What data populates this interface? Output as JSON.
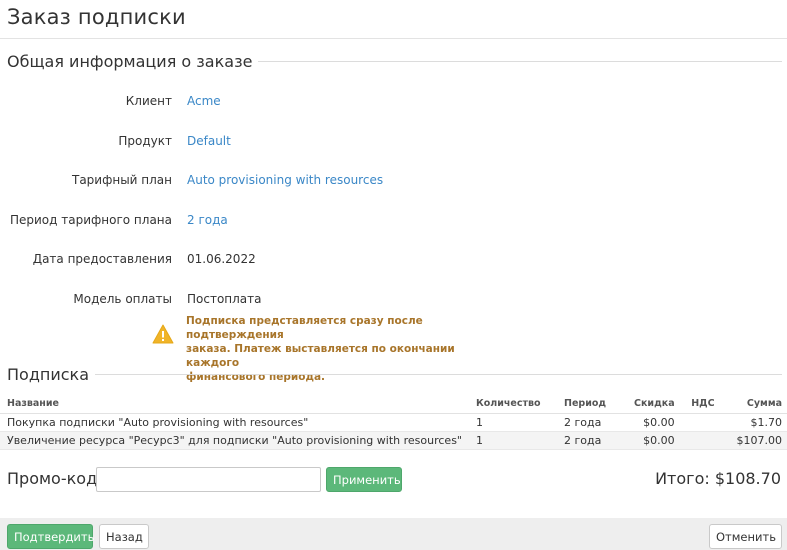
{
  "page": {
    "title": "Заказ подписки"
  },
  "general": {
    "legend": "Общая информация о заказе",
    "fields": [
      {
        "label": "Клиент",
        "value": "Acme"
      },
      {
        "label": "Продукт",
        "value": "Default"
      },
      {
        "label": "Тарифный план",
        "value": "Auto provisioning with resources"
      },
      {
        "label": "Период тарифного плана",
        "value": "2 года"
      },
      {
        "label": "Дата предоставления",
        "value": "01.06.2022"
      },
      {
        "label": "Модель оплаты",
        "value": "Постоплата"
      }
    ],
    "warning": {
      "icon": "warning-triangle-icon",
      "color": "#a8752a",
      "lines": [
        "Подписка представляется сразу после подтверждения",
        "заказа. Платеж выставляется по окончании каждого",
        "финансового периода."
      ]
    }
  },
  "subscription": {
    "legend": "Подписка",
    "columns": [
      "Название",
      "Количество",
      "Период",
      "Скидка",
      "НДС",
      "Сумма"
    ],
    "rows": [
      {
        "name": "Покупка подписки \"Auto provisioning with resources\"",
        "qty": "1",
        "period": "2 года",
        "discount": "$0.00",
        "vat": "",
        "sum": "$1.70"
      },
      {
        "name": "Увеличение ресурса \"Ресурс3\" для подписки \"Auto provisioning with resources\"",
        "qty": "1",
        "period": "2 года",
        "discount": "$0.00",
        "vat": "",
        "sum": "$107.00"
      }
    ]
  },
  "promo": {
    "label": "Промо-код",
    "value": "",
    "apply_label": "Применить"
  },
  "total": {
    "text": "Итого: $108.70"
  },
  "footer": {
    "confirm_label": "Подтвердить",
    "back_label": "Назад",
    "cancel_label": "Отменить"
  },
  "colors": {
    "link": "#3a87c7",
    "primary_button": "#5cb87a",
    "warning_text": "#a8752a"
  }
}
